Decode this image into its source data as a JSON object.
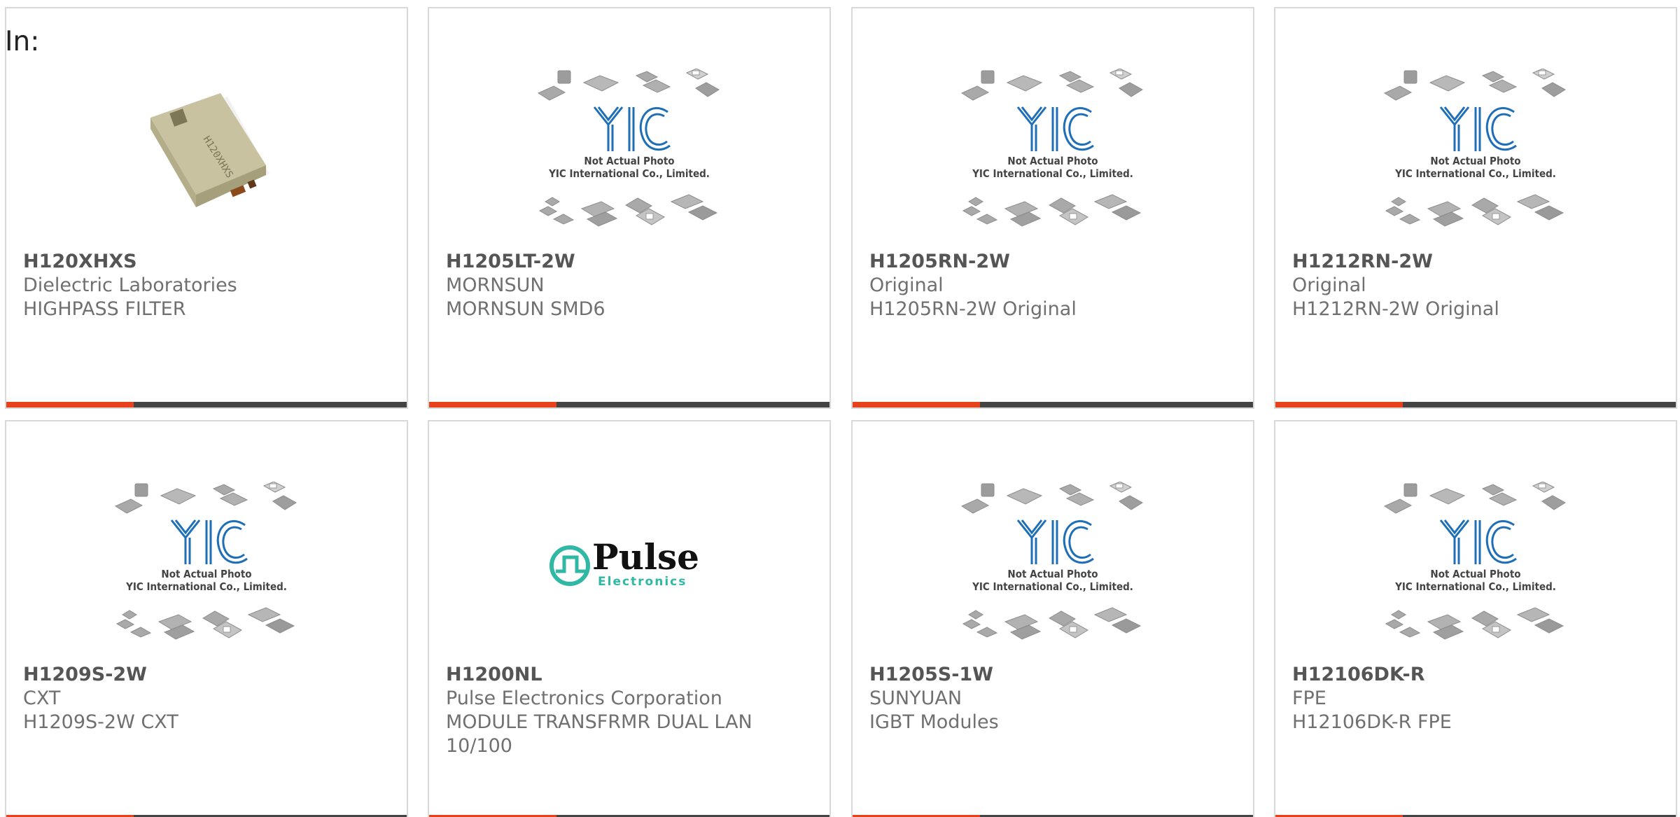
{
  "header": {
    "label": "In:"
  },
  "colors": {
    "accent": "#e8421c",
    "bar": "#444444",
    "yic_blue": "#1f6fb8",
    "pulse_teal": "#2fb8a3"
  },
  "placeholder": {
    "logo_text": "YIC",
    "line1": "Not Actual Photo",
    "line2": "YIC International Co., Limited."
  },
  "pulse_logo": {
    "word": "Pulse",
    "sub": "Electronics"
  },
  "products": [
    {
      "part": "H120XHXS",
      "manufacturer": "Dielectric Laboratories",
      "description": "HIGHPASS FILTER",
      "image": "component-photo",
      "chip_marking": "H120XHXS"
    },
    {
      "part": "H1205LT-2W",
      "manufacturer": "MORNSUN",
      "description": "MORNSUN SMD6",
      "image": "yic-placeholder"
    },
    {
      "part": "H1205RN-2W",
      "manufacturer": "Original",
      "description": "H1205RN-2W Original",
      "image": "yic-placeholder"
    },
    {
      "part": "H1212RN-2W",
      "manufacturer": "Original",
      "description": "H1212RN-2W Original",
      "image": "yic-placeholder"
    },
    {
      "part": "H1209S-2W",
      "manufacturer": "CXT",
      "description": "H1209S-2W CXT",
      "image": "yic-placeholder"
    },
    {
      "part": "H1200NL",
      "manufacturer": "Pulse Electronics Corporation",
      "description": "MODULE TRANSFRMR DUAL LAN 10/100",
      "image": "pulse-logo"
    },
    {
      "part": "H1205S-1W",
      "manufacturer": "SUNYUAN",
      "description": "IGBT Modules",
      "image": "yic-placeholder"
    },
    {
      "part": "H12106DK-R",
      "manufacturer": "FPE",
      "description": "H12106DK-R FPE",
      "image": "yic-placeholder"
    }
  ]
}
